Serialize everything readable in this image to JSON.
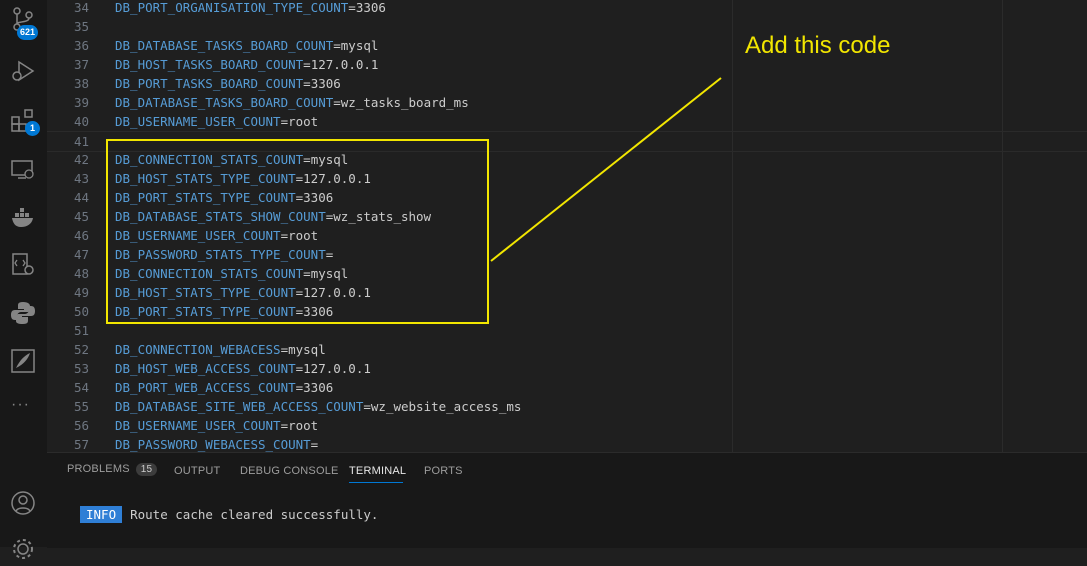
{
  "activity_bar": {
    "source_control_badge": "621",
    "extensions_badge": "1",
    "more_label": "···"
  },
  "editor": {
    "lines": [
      {
        "n": "34",
        "key": "DB_PORT_ORGANISATION_TYPE_COUNT",
        "val": "3306"
      },
      {
        "n": "35",
        "key": "",
        "val": ""
      },
      {
        "n": "36",
        "key": "DB_DATABASE_TASKS_BOARD_COUNT",
        "val": "mysql"
      },
      {
        "n": "37",
        "key": "DB_HOST_TASKS_BOARD_COUNT",
        "val": "127.0.0.1"
      },
      {
        "n": "38",
        "key": "DB_PORT_TASKS_BOARD_COUNT",
        "val": "3306"
      },
      {
        "n": "39",
        "key": "DB_DATABASE_TASKS_BOARD_COUNT",
        "val": "wz_tasks_board_ms"
      },
      {
        "n": "40",
        "key": "DB_USERNAME_USER_COUNT",
        "val": "root"
      },
      {
        "n": "41",
        "key": "",
        "val": ""
      },
      {
        "n": "42",
        "key": "DB_CONNECTION_STATS_COUNT",
        "val": "mysql"
      },
      {
        "n": "43",
        "key": "DB_HOST_STATS_TYPE_COUNT",
        "val": "127.0.0.1"
      },
      {
        "n": "44",
        "key": "DB_PORT_STATS_TYPE_COUNT",
        "val": "3306"
      },
      {
        "n": "45",
        "key": "DB_DATABASE_STATS_SHOW_COUNT",
        "val": "wz_stats_show"
      },
      {
        "n": "46",
        "key": "DB_USERNAME_USER_COUNT",
        "val": "root"
      },
      {
        "n": "47",
        "key": "DB_PASSWORD_STATS_TYPE_COUNT",
        "val": ""
      },
      {
        "n": "48",
        "key": "DB_CONNECTION_STATS_COUNT",
        "val": "mysql"
      },
      {
        "n": "49",
        "key": "DB_HOST_STATS_TYPE_COUNT",
        "val": "127.0.0.1"
      },
      {
        "n": "50",
        "key": "DB_PORT_STATS_TYPE_COUNT",
        "val": "3306"
      },
      {
        "n": "51",
        "key": "",
        "val": ""
      },
      {
        "n": "52",
        "key": "DB_CONNECTION_WEBACESS",
        "val": "mysql"
      },
      {
        "n": "53",
        "key": "DB_HOST_WEB_ACCESS_COUNT",
        "val": "127.0.0.1"
      },
      {
        "n": "54",
        "key": "DB_PORT_WEB_ACCESS_COUNT",
        "val": "3306"
      },
      {
        "n": "55",
        "key": "DB_DATABASE_SITE_WEB_ACCESS_COUNT",
        "val": "wz_website_access_ms"
      },
      {
        "n": "56",
        "key": "DB_USERNAME_USER_COUNT",
        "val": "root"
      },
      {
        "n": "57",
        "key": "DB_PASSWORD_WEBACESS_COUNT",
        "val": ""
      }
    ]
  },
  "annotation": {
    "text": "Add this code",
    "color": "#f2e600"
  },
  "panel": {
    "tabs": {
      "problems": "PROBLEMS",
      "problems_count": "15",
      "output": "OUTPUT",
      "debug_console": "DEBUG CONSOLE",
      "terminal": "TERMINAL",
      "ports": "PORTS"
    },
    "terminal": {
      "level": "INFO",
      "message": "Route cache cleared successfully."
    }
  }
}
